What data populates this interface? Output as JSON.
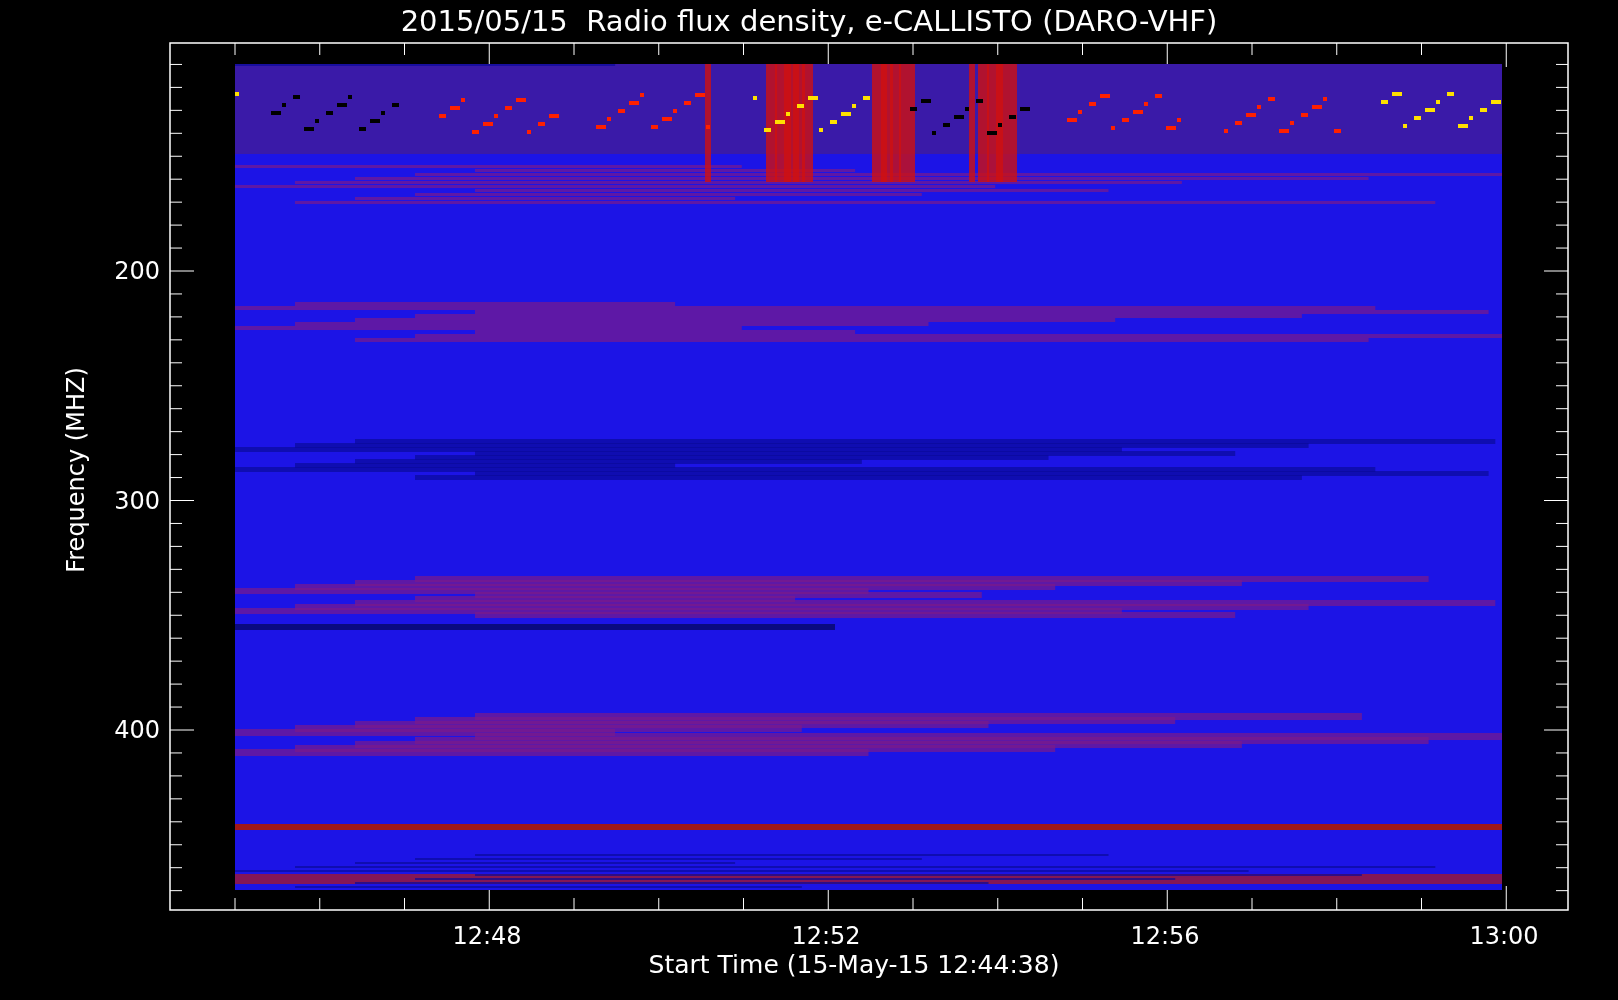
{
  "plot": {
    "title": "2015/05/15  Radio flux density, e-CALLISTO (DARO-VHF)",
    "ylabel": "Frequency (MHZ)",
    "xlabel": "Start Time (15-May-15 12:44:38)",
    "yticks": [
      "200",
      "300",
      "400"
    ],
    "xticks": [
      "12:48",
      "12:52",
      "12:56",
      "13:00"
    ]
  }
}
